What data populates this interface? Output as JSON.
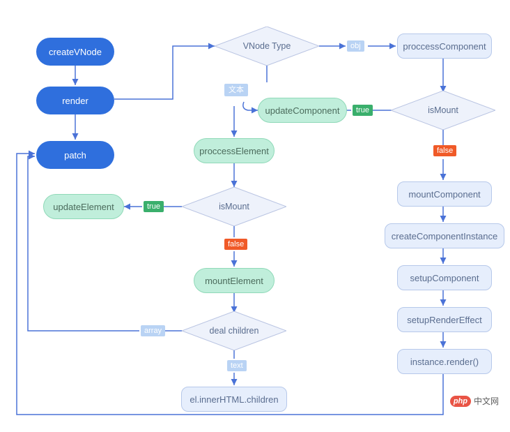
{
  "nodes": {
    "createVNode": "createVNode",
    "render": "render",
    "patch": "patch",
    "vnodeType": "VNode Type",
    "proccessComponent": "proccessComponent",
    "updateComponent": "updateComponent",
    "isMount1": "isMount",
    "proccessElement": "proccessElement",
    "isMount2": "isMount",
    "updateElement": "updateElement",
    "mountElement": "mountElement",
    "dealChildren": "deal children",
    "elInnerHTML": "el.innerHTML.children",
    "mountComponent": "mountComponent",
    "createComponentInstance": "createComponentInstance",
    "setupComponent": "setupComponent",
    "setupRenderEffect": "setupRenderEffect",
    "instanceRender": "instance.render()"
  },
  "tags": {
    "obj": "obj",
    "text_cn": "文本",
    "true1": "true",
    "false1": "false",
    "true2": "true",
    "false2": "false",
    "array": "array",
    "text_en": "text"
  },
  "watermark": {
    "php": "php",
    "cn": "中文网"
  },
  "colors": {
    "blue": "#2f6fdd",
    "boxLight": "#e6eefc",
    "boxBorder": "#b6c8ea",
    "green": "#c0eedb",
    "tagGreen": "#3aaf6c",
    "tagOrange": "#f05a28",
    "tagLightBlue": "#b9d3f4",
    "wire": "#4a72d7",
    "diamondFill": "#eef2fb",
    "diamondStroke": "#b9c4e2"
  }
}
